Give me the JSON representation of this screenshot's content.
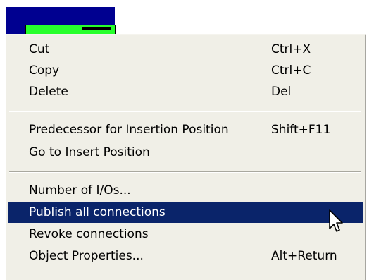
{
  "menu": {
    "items": [
      {
        "label": "Cut",
        "shortcut": "Ctrl+X"
      },
      {
        "label": "Copy",
        "shortcut": "Ctrl+C"
      },
      {
        "label": "Delete",
        "shortcut": "Del"
      },
      {
        "label": "Predecessor for Insertion Position",
        "shortcut": "Shift+F11"
      },
      {
        "label": "Go to Insert Position",
        "shortcut": ""
      },
      {
        "label": "Number of I/Os...",
        "shortcut": ""
      },
      {
        "label": "Publish all connections",
        "shortcut": ""
      },
      {
        "label": "Revoke connections",
        "shortcut": ""
      },
      {
        "label": "Object Properties...",
        "shortcut": "Alt+Return"
      }
    ],
    "highlighted_item": "Publish all connections"
  },
  "colors": {
    "menu_background": "#f0efe7",
    "highlight_background": "#0a246a",
    "highlight_text": "#ffffff",
    "background_window": "#000090",
    "node_green": "#27ff2c"
  },
  "icons": {
    "cursor": "arrow-pointer-icon"
  }
}
